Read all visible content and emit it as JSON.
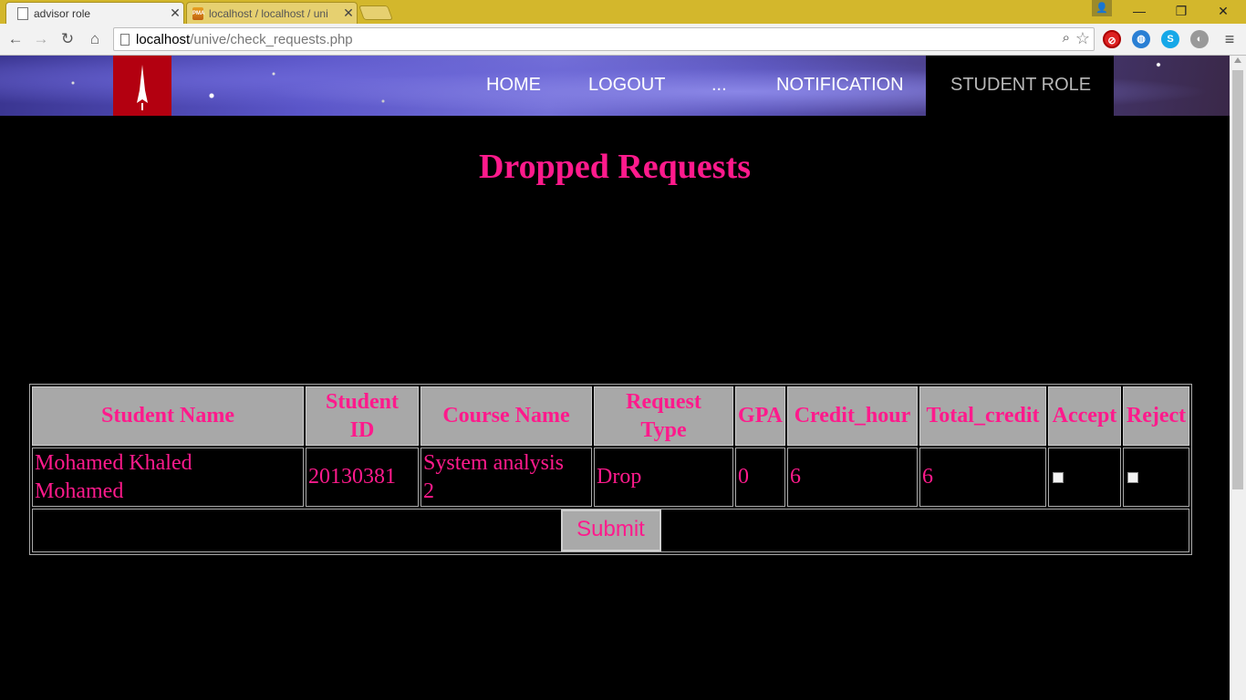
{
  "browser": {
    "tabs": [
      {
        "title": "advisor role",
        "active": true
      },
      {
        "title": "localhost / localhost / uni",
        "active": false
      }
    ],
    "address": {
      "host": "localhost",
      "path": "/unive/check_requests.php"
    },
    "window_controls": {
      "minimize": "—",
      "restore": "❐",
      "close": "✕"
    }
  },
  "nav": {
    "home": "HOME",
    "logout": "LOGOUT",
    "more": "...",
    "notification": "NOTIFICATION",
    "student_role": "STUDENT ROLE"
  },
  "page": {
    "title": "Dropped Requests"
  },
  "table": {
    "headers": {
      "student_name": "Student Name",
      "student_id_1": "Student",
      "student_id_2": "ID",
      "course_name": "Course Name",
      "request_type_1": "Request",
      "request_type_2": "Type",
      "gpa": "GPA",
      "credit_hour": "Credit_hour",
      "total_credit": "Total_credit",
      "accept": "Accept",
      "reject": "Reject"
    },
    "rows": [
      {
        "student_name_1": "Mohamed Khaled",
        "student_name_2": "Mohamed",
        "student_id": "20130381",
        "course_name_1": "System analysis",
        "course_name_2": "2",
        "request_type": "Drop",
        "gpa": "0",
        "credit_hour": "6",
        "total_credit": "6"
      }
    ],
    "submit_label": "Submit"
  },
  "colors": {
    "accent": "#ff1a8c",
    "header_bg": "#a8a8a8",
    "logo_bg": "#b30010",
    "titlebar": "#d3b72c"
  }
}
